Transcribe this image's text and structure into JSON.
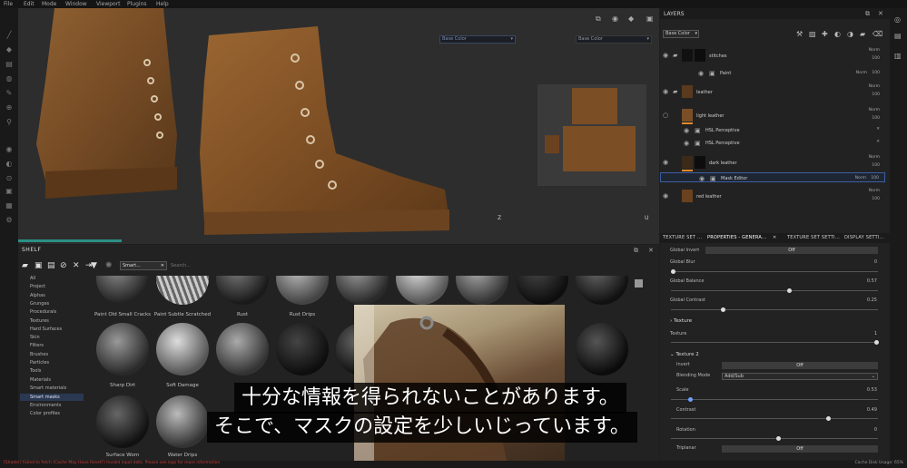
{
  "menubar": [
    "File",
    "Edit",
    "Mode",
    "Window",
    "Viewport",
    "Plugins",
    "Help"
  ],
  "viewport": {
    "channel_left": "Base Color",
    "channel_right": "Base Color",
    "axis_3d": "Z",
    "axis_uv": "U"
  },
  "shelf": {
    "title": "SHELF",
    "search_chip": "Smart...",
    "search_placeholder": "Search...",
    "categories": [
      "All",
      "Project",
      "Alphas",
      "Grunges",
      "Procedurals",
      "Textures",
      "Hard Surfaces",
      "Skin",
      "Filters",
      "Brushes",
      "Particles",
      "Tools",
      "Materials",
      "Smart materials",
      "Smart masks",
      "Environments",
      "Color profiles"
    ],
    "selected_category": "Smart masks",
    "thumb_labels": [
      "Paint Old Small Cracks",
      "Paint Subtle Scratched",
      "Rust",
      "Rust Drips",
      "Sharp Dirt",
      "Soft Damage",
      "Surface Worn",
      "Water Drips"
    ]
  },
  "layers": {
    "title": "LAYERS",
    "channel": "Base Color",
    "blend": "Norm",
    "opacity": "100",
    "items": [
      {
        "name": "stitches"
      },
      {
        "name": "Paint"
      },
      {
        "name": "leather"
      },
      {
        "name": "light leather"
      },
      {
        "name": "HSL Perceptive"
      },
      {
        "name": "HSL Perceptive"
      },
      {
        "name": "dark leather"
      },
      {
        "name": "Mask Editor"
      },
      {
        "name": "red leather"
      }
    ]
  },
  "properties": {
    "tabs": [
      "TEXTURE SET ...",
      "PROPERTIES - GENERA...",
      "TEXTURE SET SETTI...",
      "DISPLAY SETTI..."
    ],
    "global_invert_label": "Global Invert",
    "global_invert_value": "Off",
    "global_blur_label": "Global Blur",
    "global_blur_value": "0",
    "global_balance_label": "Global Balance",
    "global_balance_value": "0.57",
    "global_contrast_label": "Global Contrast",
    "global_contrast_value": "0.25",
    "texture_section": "Texture",
    "texture_label": "Texture",
    "texture_value": "1",
    "texture2_section": "Texture 2",
    "invert_label": "Invert",
    "invert_value": "Off",
    "blending_mode_label": "Blending Mode",
    "blending_mode_value": "Add/Sub",
    "scale_label": "Scale",
    "scale_value": "0.53",
    "contrast_label": "Contrast",
    "contrast_value": "0.49",
    "rotation_label": "Rotation",
    "rotation_value": "0",
    "triplanar_label": "Triplanar",
    "triplanar_value": "Off"
  },
  "status": {
    "error": "[Shader] Failed to fetch (Cache May Have Reset?) Invalid input data. Please see logs for more information",
    "right": "Cache Disk Usage:  65%"
  },
  "subtitles": {
    "line1": "十分な情報を得られないことがあります。",
    "line2": "そこで、マスクの設定を少しいじっています。"
  },
  "colors": {
    "accent_blue": "#3d5fa3",
    "layer_orange": "#e08a2c",
    "teal_progress": "#2b8f85",
    "error_red": "#c63a3a"
  }
}
